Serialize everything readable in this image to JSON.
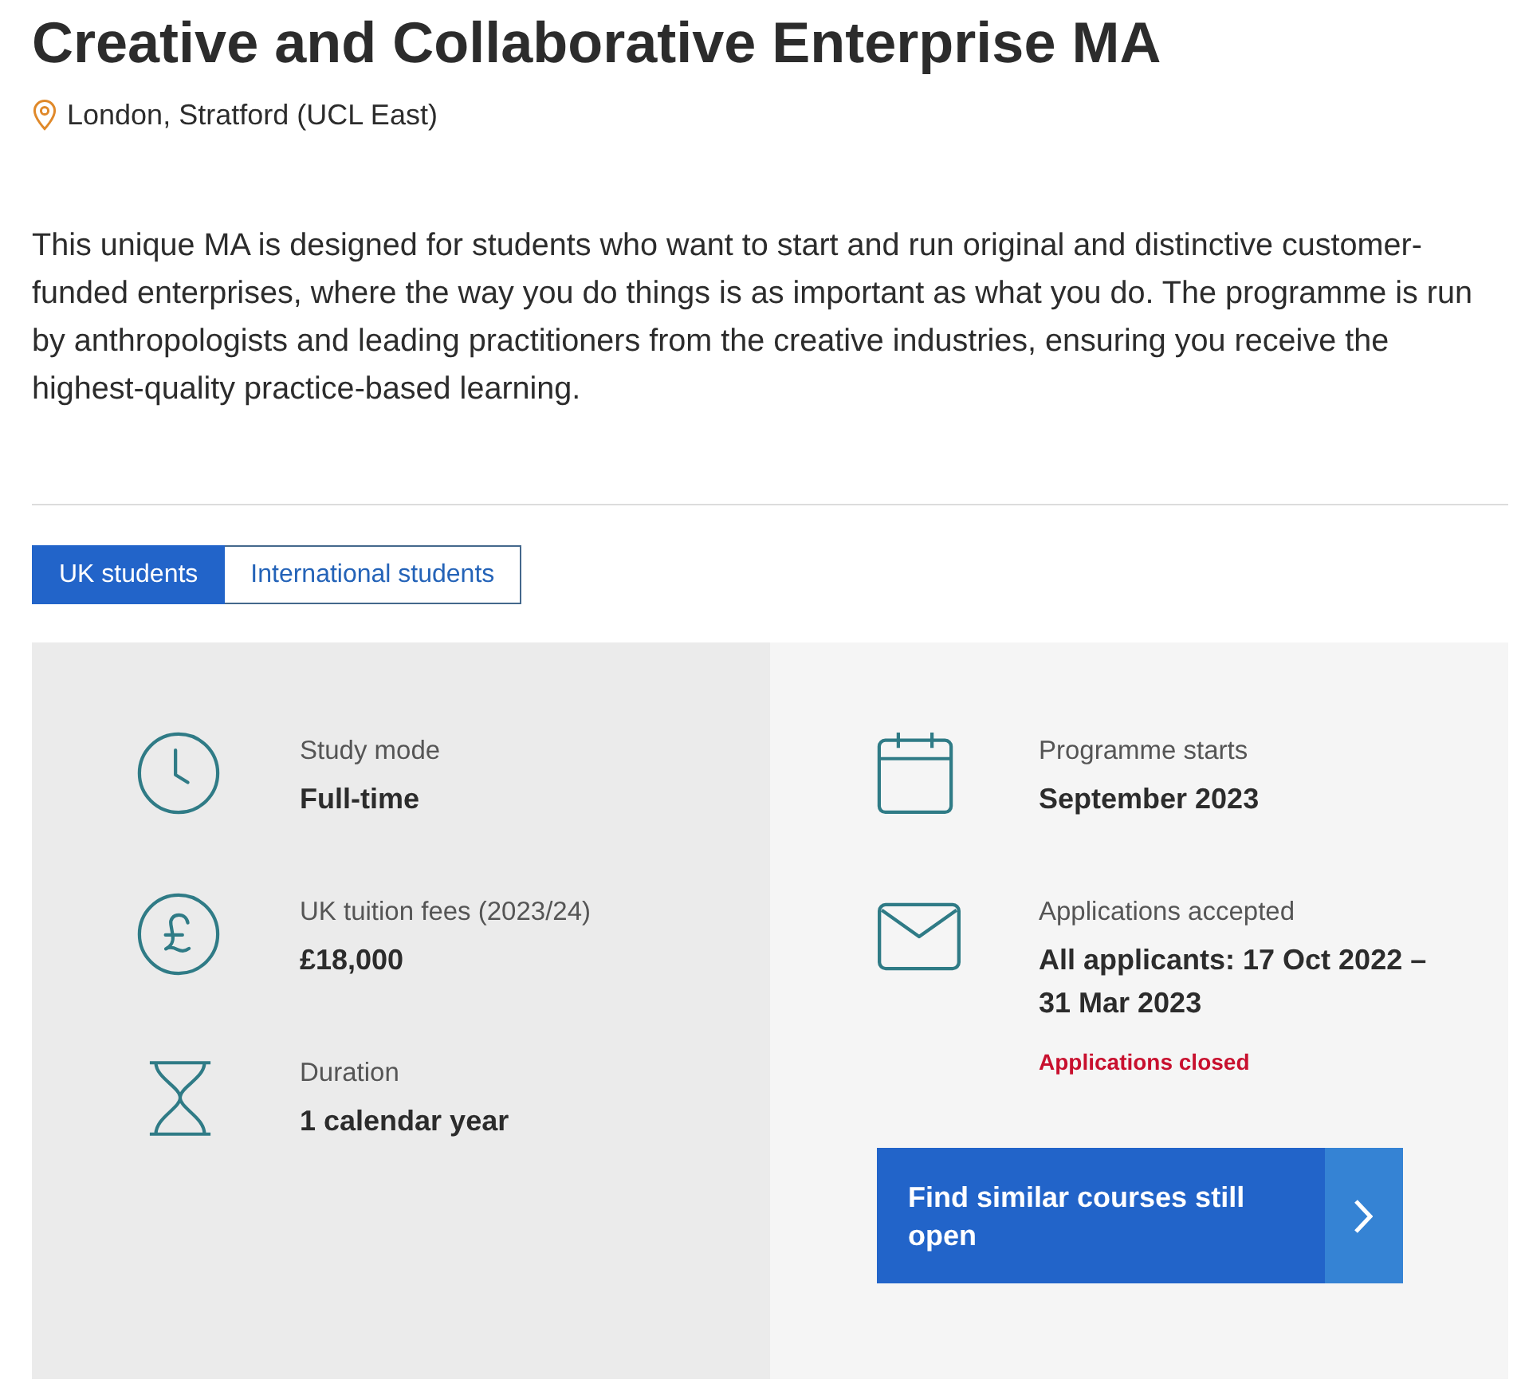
{
  "heading": {
    "title": "Creative and Collaborative Enterprise MA",
    "location": "London, Stratford (UCL East)"
  },
  "intro": "This unique MA is designed for students who want to start and run original and distinctive customer-funded enterprises, where the way you do things is as important as what you do. The programme is run by anthropologists and leading practitioners from the creative industries, ensuring you receive the highest-quality practice-based learning.",
  "tabs": [
    {
      "label": "UK students",
      "selected": true
    },
    {
      "label": "International students",
      "selected": false
    }
  ],
  "columns": [
    {
      "facts": [
        {
          "kind": "mode",
          "label": "Study mode",
          "value": "Full-time"
        },
        {
          "kind": "fees",
          "label": "UK tuition fees (2023/24)",
          "value": "£18,000"
        },
        {
          "kind": "duration",
          "label": "Duration",
          "value": "1 calendar year"
        }
      ]
    },
    {
      "facts": [
        {
          "kind": "start",
          "label": "Programme starts",
          "value": "September 2023"
        },
        {
          "kind": "applications",
          "label": "Applications accepted",
          "value": "All applicants: 17 Oct 2022 – 31 Mar 2023",
          "note": "Applications closed"
        }
      ],
      "button": {
        "label": "Find similar courses still open"
      }
    }
  ]
}
